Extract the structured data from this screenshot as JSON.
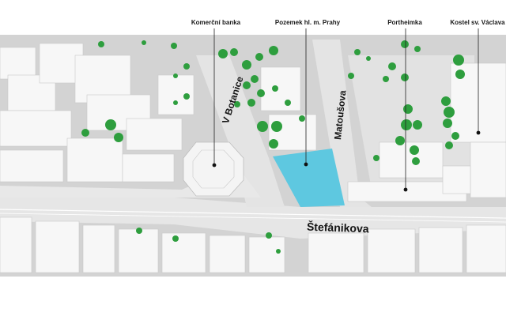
{
  "labels": {
    "komercni_banka": "Komerční banka",
    "pozemek": "Pozemek hl. m. Prahy",
    "portheimka": "Portheimka",
    "kostel": "Kostel sv. Václava"
  },
  "streets": {
    "stefanikova": "Štefánikova",
    "v_botanice": "V Botanice",
    "matousova": "Matoušova"
  },
  "colors": {
    "plot_highlight": "#5ec8e0",
    "road": "#e3e3e3",
    "ground": "#d2d2d2",
    "building": "#f6f6f6",
    "tree": "#2e9e3e"
  }
}
